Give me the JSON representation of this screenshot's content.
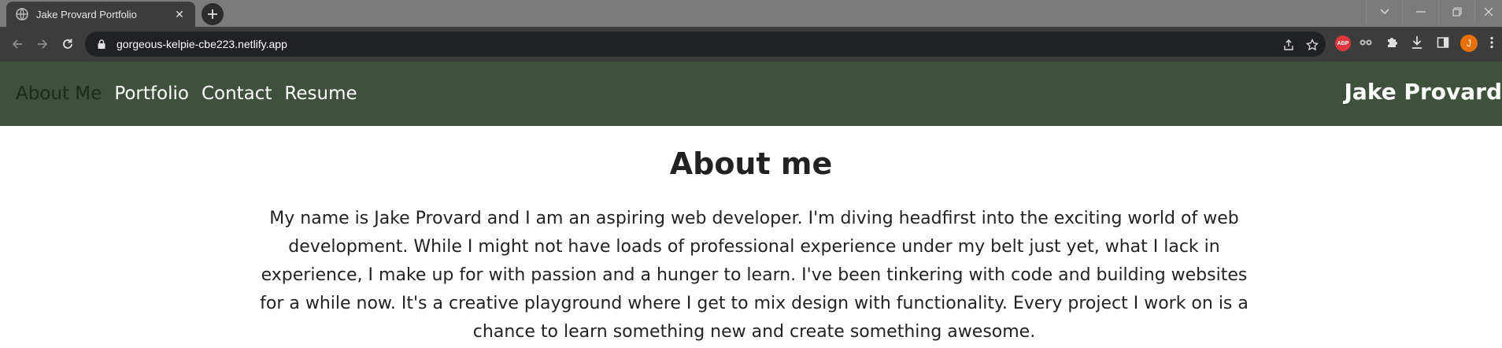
{
  "browser": {
    "tab": {
      "title": "Jake Provard Portfolio",
      "close_glyph": "✕"
    },
    "newtab_glyph": "+",
    "url": "gorgeous-kelpie-cbe223.netlify.app",
    "extensions": {
      "abp_label": "ABP",
      "avatar_initial": "J"
    },
    "icons": [
      "globe-icon",
      "back-icon",
      "forward-icon",
      "reload-icon",
      "lock-icon",
      "share-icon",
      "star-icon",
      "adblock-icon",
      "glasses-icon",
      "puzzle-icon",
      "download-icon",
      "sidepanel-icon",
      "kebab-menu-icon",
      "tab-search-icon",
      "minimize-icon",
      "restore-icon",
      "close-icon"
    ],
    "colors": {
      "tabstrip": "#7b7b7b",
      "toolbar": "#3c3c3c",
      "omnibox": "#202124",
      "avatar": "#e8710a",
      "abp": "#e0373f"
    }
  },
  "site": {
    "nav": [
      {
        "label": "About Me",
        "active": true
      },
      {
        "label": "Portfolio"
      },
      {
        "label": "Contact"
      },
      {
        "label": "Resume"
      }
    ],
    "brand": "Jake Provard",
    "colors": {
      "header_bg": "#3d513b",
      "active_link": "#1c2a1b",
      "link": "#ffffff"
    }
  },
  "about": {
    "heading": "About me",
    "body": "My name is Jake Provard and I am an aspiring web developer. I'm diving headfirst into the exciting world of web development. While I might not have loads of professional experience under my belt just yet, what I lack in experience, I make up for with passion and a hunger to learn. I've been tinkering with code and building websites for a while now. It's a creative playground where I get to mix design with functionality. Every project I work on is a chance to learn something new and create something awesome."
  }
}
